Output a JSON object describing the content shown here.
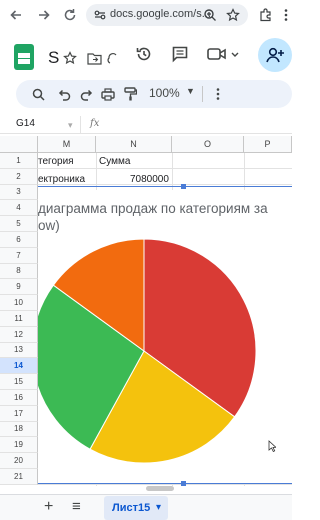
{
  "browser": {
    "url": "docs.google.com/s...",
    "icons": [
      "arrow-left-icon",
      "arrow-right-icon",
      "reload-icon",
      "site-info-icon",
      "zoom-icon",
      "star-icon",
      "extensions-icon",
      "menu-dots-icon"
    ]
  },
  "header": {
    "title": "S",
    "icons": [
      "star-icon",
      "move-folder-icon",
      "cloud-status-icon",
      "history-icon",
      "comments-icon",
      "meet-icon",
      "share-icon"
    ]
  },
  "toolbar": {
    "zoom": "100%",
    "icons": [
      "search-icon",
      "undo-icon",
      "redo-icon",
      "print-icon",
      "paint-format-icon"
    ]
  },
  "formula_bar": {
    "cell_ref": "G14",
    "fx": "fx"
  },
  "grid": {
    "columns": [
      "M",
      "N",
      "O",
      "P"
    ],
    "rows": [
      "1",
      "2",
      "3",
      "4",
      "5",
      "6",
      "7",
      "8",
      "9",
      "10",
      "11",
      "12",
      "13",
      "14",
      "15",
      "16",
      "17",
      "18",
      "19",
      "20",
      "21"
    ],
    "selected_row": "14",
    "cells": {
      "m1": "тегория",
      "n1": "Сумма",
      "m2": "ектроника",
      "n2": "7080000"
    }
  },
  "chart": {
    "title_line1": "диаграмма продаж по категориям за",
    "title_line2": "ow)"
  },
  "chart_data": {
    "type": "pie",
    "title": "диаграмма продаж по категориям за ... ow)",
    "slices": [
      {
        "color": "#d93b35",
        "fraction": 0.35
      },
      {
        "color": "#f4c20d",
        "fraction": 0.23
      },
      {
        "color": "#3cba54",
        "fraction": 0.27
      },
      {
        "color": "#f26b0f",
        "fraction": 0.15
      }
    ]
  },
  "bottom": {
    "add_label": "+",
    "list_label": "≡",
    "sheet_tab": "Лист15",
    "sheet_tab_arrow": "▾"
  }
}
